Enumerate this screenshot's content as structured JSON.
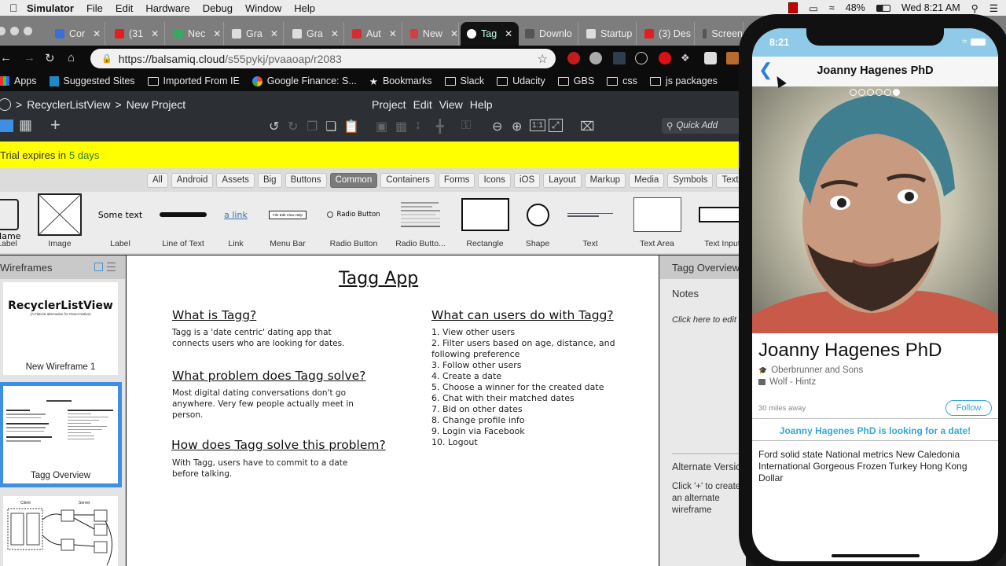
{
  "menubar": {
    "app": "Simulator",
    "items": [
      "File",
      "Edit",
      "Hardware",
      "Debug",
      "Window",
      "Help"
    ],
    "battery": "48%",
    "clock": "Wed 8:21 AM"
  },
  "browser": {
    "tabs": [
      {
        "label": "Cor",
        "icon": "extension-icon",
        "color": "#3a6fd8"
      },
      {
        "label": "(31",
        "icon": "youtube-icon",
        "color": "#e02020"
      },
      {
        "label": "Nec",
        "icon": "map-icon",
        "color": "#3aa860"
      },
      {
        "label": "Gra",
        "icon": "document-icon",
        "color": "#dddddd"
      },
      {
        "label": "Gra",
        "icon": "document-icon",
        "color": "#dddddd"
      },
      {
        "label": "Aut",
        "icon": "auth-icon",
        "color": "#d03030"
      },
      {
        "label": "New",
        "icon": "gmail-icon",
        "color": "#d04040"
      },
      {
        "label": "Tag",
        "icon": "smiley-icon",
        "color": "#ffffff",
        "active": true
      },
      {
        "label": "Downlo",
        "icon": "page-icon",
        "color": "#555555"
      },
      {
        "label": "Startup",
        "icon": "victory-icon",
        "color": "#dddddd"
      },
      {
        "label": "(3) Des",
        "icon": "youtube-icon",
        "color": "#e02020"
      },
      {
        "label": "Screen",
        "icon": "page-icon",
        "color": "#555555"
      }
    ],
    "url_host": "https://balsamiq.cloud",
    "url_path": "/s55pykj/pvaaoap/r2083",
    "bookmarks": [
      "Apps",
      "Suggested Sites",
      "Imported From IE",
      "Google Finance: S...",
      "Bookmarks",
      "Slack",
      "Udacity",
      "GBS",
      "css",
      "js packages"
    ]
  },
  "balsamiq": {
    "breadcrumb_project": "RecyclerListView",
    "breadcrumb_sep": ">",
    "breadcrumb_page": "New Project",
    "menu": [
      "Project",
      "Edit",
      "View",
      "Help"
    ],
    "quick_add_placeholder": "Quick Add",
    "trial_prefix": "Trial expires in",
    "trial_days": "5 days",
    "filters": [
      {
        "label": "All"
      },
      {
        "label": "Android"
      },
      {
        "label": "Assets"
      },
      {
        "label": "Big"
      },
      {
        "label": "Buttons"
      },
      {
        "label": "Common",
        "selected": true
      },
      {
        "label": "Containers"
      },
      {
        "label": "Forms"
      },
      {
        "label": "Icons"
      },
      {
        "label": "iOS"
      },
      {
        "label": "Layout"
      },
      {
        "label": "Markup"
      },
      {
        "label": "Media"
      },
      {
        "label": "Symbols"
      },
      {
        "label": "Text"
      }
    ],
    "components": [
      {
        "label": "Label",
        "preview_text": "Name"
      },
      {
        "label": "Image"
      },
      {
        "label": "Label",
        "preview_text": "Some text"
      },
      {
        "label": "Line of Text"
      },
      {
        "label": "Link",
        "preview_text": "a link"
      },
      {
        "label": "Menu Bar",
        "preview_text": "File  Edit  View  Help"
      },
      {
        "label": "Radio Button",
        "preview_text": "Radio Button"
      },
      {
        "label": "Radio Butto..."
      },
      {
        "label": "Rectangle"
      },
      {
        "label": "Shape"
      },
      {
        "label": "Text"
      },
      {
        "label": "Text Area"
      },
      {
        "label": "Text Input"
      }
    ],
    "wireframes_panel": {
      "title": "Wireframes",
      "items": [
        {
          "name": "New Wireframe 1",
          "thumb_title": "RecyclerListView",
          "thumb_sub": "(A FlatList alternative for React Native)"
        },
        {
          "name": "Tagg Overview",
          "selected": true
        },
        {
          "name": "",
          "thumb_labels": [
            "Client",
            "Server"
          ]
        }
      ]
    },
    "canvas": {
      "title": "Tagg App",
      "sections": [
        {
          "heading": "What is Tagg?",
          "body": "Tagg is a 'date centric' dating app that connects users who are looking for dates."
        },
        {
          "heading": "What problem does Tagg solve?",
          "body": "Most digital dating conversations don't go anywhere. Very few people actually meet in person."
        },
        {
          "heading": "How does Tagg solve this problem?",
          "body": "With Tagg, users have to commit to a date before talking."
        }
      ],
      "features_heading": "What can users do with Tagg?",
      "features": [
        "1. View other users",
        "2. Filter users based on age, distance, and following preference",
        "3. Follow other users",
        "4. Create a date",
        "5. Choose a winner for the created date",
        "6. Chat with their matched dates",
        "7. Bid on other dates",
        "8. Change profile info",
        "9. Login via Facebook",
        "10. Logout"
      ]
    },
    "inspector": {
      "title": "Tagg Overview",
      "notes_label": "Notes",
      "notes_placeholder": "Click here to edit notes",
      "alt_label": "Alternate Versions",
      "alt_hint": "Click '+' to create an alternate wireframe"
    }
  },
  "phone": {
    "time": "8:21",
    "nav_title": "Joanny Hagenes PhD",
    "carousel_total": 6,
    "carousel_active": 6,
    "name": "Joanny Hagenes PhD",
    "school": "Oberbrunner and Sons",
    "work": "Wolf - Hintz",
    "distance": "30  miles away",
    "follow_label": "Follow",
    "looking": "Joanny Hagenes PhD is looking for a date!",
    "description": "Ford solid state National metrics New Caledonia International Gorgeous Frozen Turkey Hong Kong Dollar",
    "accent": "#35a6d8"
  }
}
